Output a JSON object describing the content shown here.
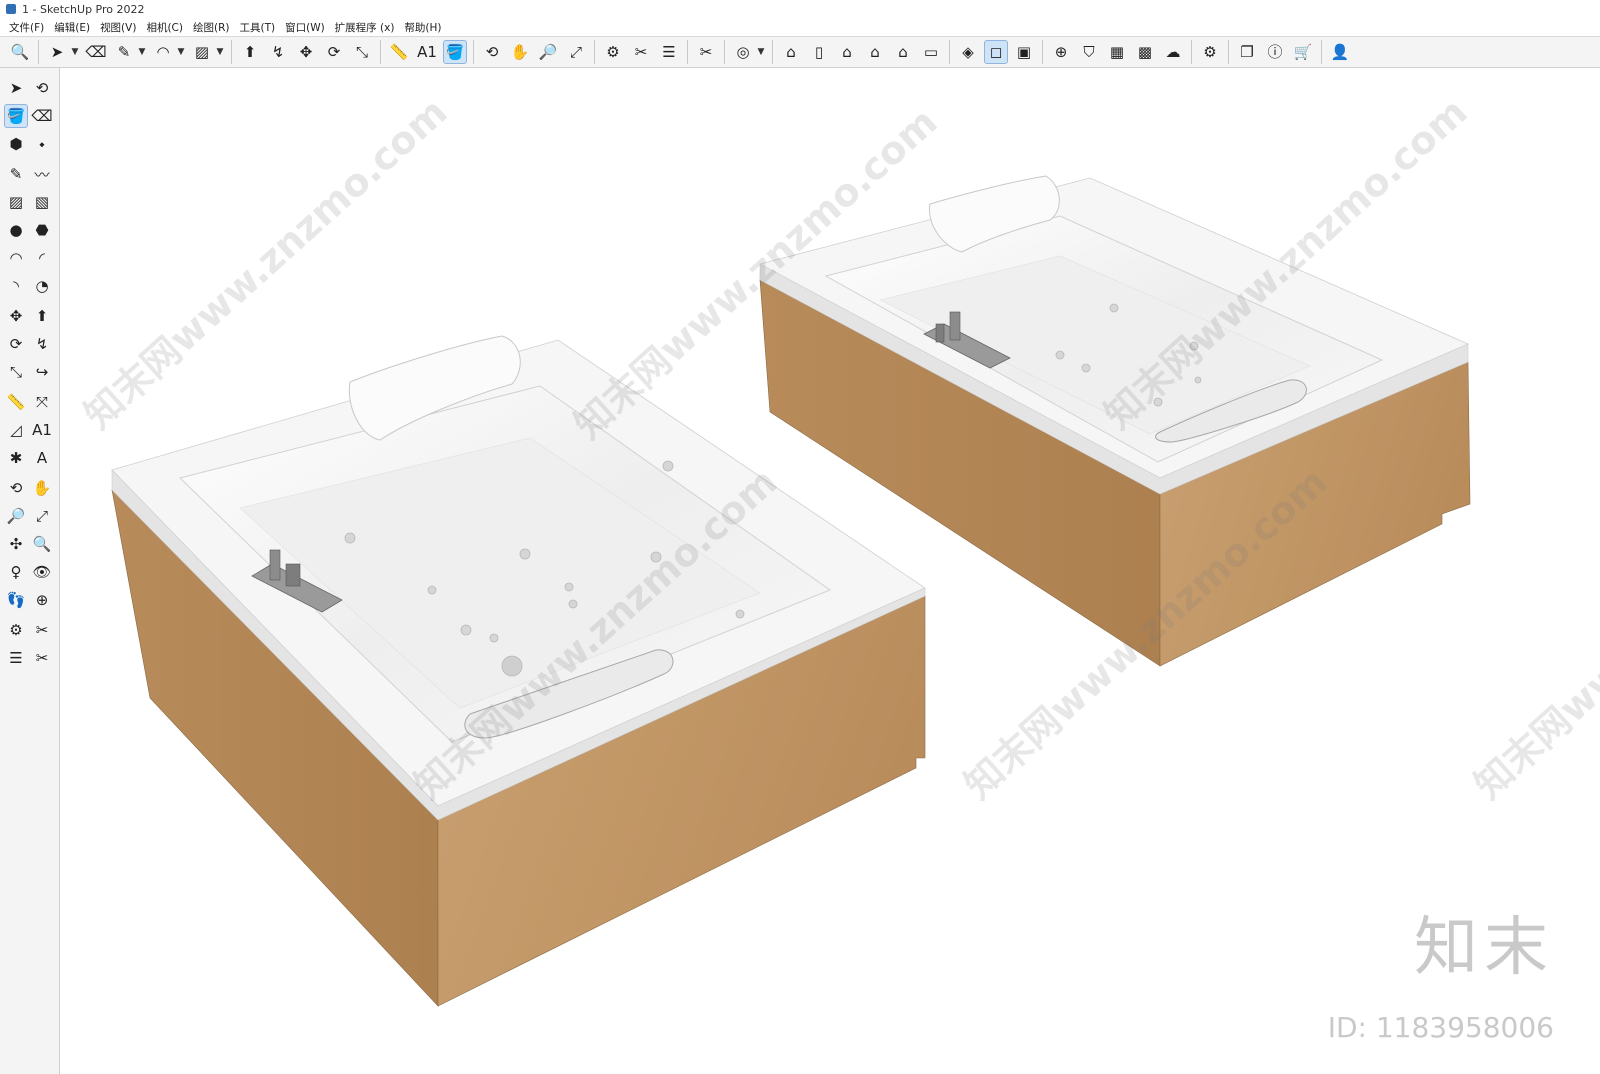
{
  "window": {
    "title": "1 - SketchUp Pro 2022"
  },
  "menu": [
    "文件(F)",
    "编辑(E)",
    "视图(V)",
    "相机(C)",
    "绘图(R)",
    "工具(T)",
    "窗口(W)",
    "扩展程序 (x)",
    "帮助(H)"
  ],
  "toolbar": [
    {
      "name": "zoom-extents-icon",
      "glyph": "🔍"
    },
    {
      "sep": true
    },
    {
      "name": "select-icon",
      "glyph": "➤"
    },
    {
      "name": "select-dropdown",
      "glyph": "▼",
      "drop": true
    },
    {
      "name": "eraser-icon",
      "glyph": "⌫"
    },
    {
      "name": "pencil-icon",
      "glyph": "✎"
    },
    {
      "name": "line-dropdown",
      "glyph": "▼",
      "drop": true
    },
    {
      "name": "arc-icon",
      "glyph": "◠"
    },
    {
      "name": "arc-dropdown",
      "glyph": "▼",
      "drop": true
    },
    {
      "name": "rectangle-icon",
      "glyph": "▨"
    },
    {
      "name": "shape-dropdown",
      "glyph": "▼",
      "drop": true
    },
    {
      "sep": true
    },
    {
      "name": "push-pull-icon",
      "glyph": "⬆"
    },
    {
      "name": "follow-me-icon",
      "glyph": "↯"
    },
    {
      "name": "move-icon",
      "glyph": "✥"
    },
    {
      "name": "rotate-icon",
      "glyph": "⟳"
    },
    {
      "name": "scale-icon",
      "glyph": "⤡"
    },
    {
      "sep": true
    },
    {
      "name": "tape-measure-icon",
      "glyph": "📏"
    },
    {
      "name": "text-icon",
      "glyph": "A1"
    },
    {
      "name": "paint-bucket-icon",
      "glyph": "🪣",
      "active": true
    },
    {
      "sep": true
    },
    {
      "name": "orbit-icon",
      "glyph": "⟲"
    },
    {
      "name": "pan-icon",
      "glyph": "✋"
    },
    {
      "name": "zoom-icon",
      "glyph": "🔎"
    },
    {
      "name": "zoom-window-icon",
      "glyph": "⤢"
    },
    {
      "sep": true
    },
    {
      "name": "warehouse-icon",
      "glyph": "⚙"
    },
    {
      "name": "extension-warehouse-icon",
      "glyph": "✂"
    },
    {
      "name": "layers-icon",
      "glyph": "☰"
    },
    {
      "sep": true
    },
    {
      "name": "send-to-layout-icon",
      "glyph": "✂"
    },
    {
      "sep": true
    },
    {
      "name": "account-icon",
      "glyph": "◎"
    },
    {
      "name": "account-dropdown",
      "glyph": "▼",
      "drop": true
    },
    {
      "sep": true
    },
    {
      "name": "iso-view-icon",
      "glyph": "⌂"
    },
    {
      "name": "top-view-icon",
      "glyph": "▯"
    },
    {
      "name": "front-view-icon",
      "glyph": "⌂"
    },
    {
      "name": "right-view-icon",
      "glyph": "⌂"
    },
    {
      "name": "back-view-icon",
      "glyph": "⌂"
    },
    {
      "name": "left-view-icon",
      "glyph": "▭"
    },
    {
      "sep": true
    },
    {
      "name": "x-ray-icon",
      "glyph": "◈"
    },
    {
      "name": "back-edges-icon",
      "glyph": "◻",
      "active": true
    },
    {
      "name": "wireframe-icon",
      "glyph": "▣"
    },
    {
      "sep": true
    },
    {
      "name": "add-icon",
      "glyph": "⊕"
    },
    {
      "name": "shield-icon",
      "glyph": "⛉"
    },
    {
      "name": "material-icon",
      "glyph": "▦"
    },
    {
      "name": "checker-icon",
      "glyph": "▩"
    },
    {
      "name": "cloud-icon",
      "glyph": "☁"
    },
    {
      "sep": true
    },
    {
      "name": "settings-icon",
      "glyph": "⚙"
    },
    {
      "sep": true
    },
    {
      "name": "window-icon",
      "glyph": "❐"
    },
    {
      "name": "info-icon",
      "glyph": "ⓘ"
    },
    {
      "name": "cart-icon",
      "glyph": "🛒"
    },
    {
      "sep": true
    },
    {
      "name": "profile-icon",
      "glyph": "👤"
    }
  ],
  "left_tools": [
    [
      {
        "name": "select-icon",
        "glyph": "➤"
      },
      {
        "name": "lasso-icon",
        "glyph": "⟲"
      }
    ],
    [
      {
        "name": "paint-bucket-icon",
        "glyph": "🪣",
        "active": true
      },
      {
        "name": "eraser-icon",
        "glyph": "⌫"
      }
    ],
    [
      {
        "name": "component-icon",
        "glyph": "⬢"
      },
      {
        "name": "tag-icon",
        "glyph": "⬩"
      }
    ],
    [
      {
        "name": "pencil-icon",
        "glyph": "✎"
      },
      {
        "name": "freehand-icon",
        "glyph": "〰"
      }
    ],
    [
      {
        "name": "rectangle-icon",
        "glyph": "▨"
      },
      {
        "name": "rotated-rectangle-icon",
        "glyph": "▧"
      }
    ],
    [
      {
        "name": "circle-icon",
        "glyph": "●"
      },
      {
        "name": "polygon-icon",
        "glyph": "⬣"
      }
    ],
    [
      {
        "name": "arc-icon",
        "glyph": "◠"
      },
      {
        "name": "two-point-arc-icon",
        "glyph": "◜"
      }
    ],
    [
      {
        "name": "three-point-arc-icon",
        "glyph": "◝"
      },
      {
        "name": "pie-icon",
        "glyph": "◔"
      }
    ],
    [
      {
        "name": "move-icon",
        "glyph": "✥"
      },
      {
        "name": "push-pull-icon",
        "glyph": "⬆"
      }
    ],
    [
      {
        "name": "rotate-icon",
        "glyph": "⟳"
      },
      {
        "name": "follow-me-icon",
        "glyph": "↯"
      }
    ],
    [
      {
        "name": "scale-icon",
        "glyph": "⤡"
      },
      {
        "name": "offset-icon",
        "glyph": "↪"
      }
    ],
    [
      {
        "name": "tape-measure-icon",
        "glyph": "📏"
      },
      {
        "name": "dimension-icon",
        "glyph": "⤧"
      }
    ],
    [
      {
        "name": "protractor-icon",
        "glyph": "◿"
      },
      {
        "name": "text-icon",
        "glyph": "A1"
      }
    ],
    [
      {
        "name": "axes-icon",
        "glyph": "✱"
      },
      {
        "name": "3d-text-icon",
        "glyph": "A"
      }
    ],
    [
      {
        "name": "orbit-icon",
        "glyph": "⟲"
      },
      {
        "name": "pan-icon",
        "glyph": "✋"
      }
    ],
    [
      {
        "name": "zoom-icon",
        "glyph": "🔎"
      },
      {
        "name": "zoom-window-icon",
        "glyph": "⤢"
      }
    ],
    [
      {
        "name": "zoom-extents-icon",
        "glyph": "✣"
      },
      {
        "name": "previous-view-icon",
        "glyph": "🔍"
      }
    ],
    [
      {
        "name": "position-camera-icon",
        "glyph": "♀"
      },
      {
        "name": "look-around-icon",
        "glyph": "👁"
      }
    ],
    [
      {
        "name": "walk-icon",
        "glyph": "👣"
      },
      {
        "name": "section-plane-icon",
        "glyph": "⊕"
      }
    ],
    [
      {
        "name": "warehouse-icon",
        "glyph": "⚙"
      },
      {
        "name": "extension-warehouse-icon",
        "glyph": "✂"
      }
    ],
    [
      {
        "name": "layers-icon",
        "glyph": "☰"
      },
      {
        "name": "send-to-layout-icon",
        "glyph": "✂"
      }
    ]
  ],
  "watermark": {
    "text": "知末网www.znzmo.com",
    "logo": "知末",
    "id_label": "ID: 1183958006"
  },
  "colors": {
    "wood": "#c49a6c",
    "wood_dark": "#a87e52",
    "acrylic": "#f2f2f2",
    "basin": "#e8e8e8",
    "selection": "#cfe3f7"
  }
}
